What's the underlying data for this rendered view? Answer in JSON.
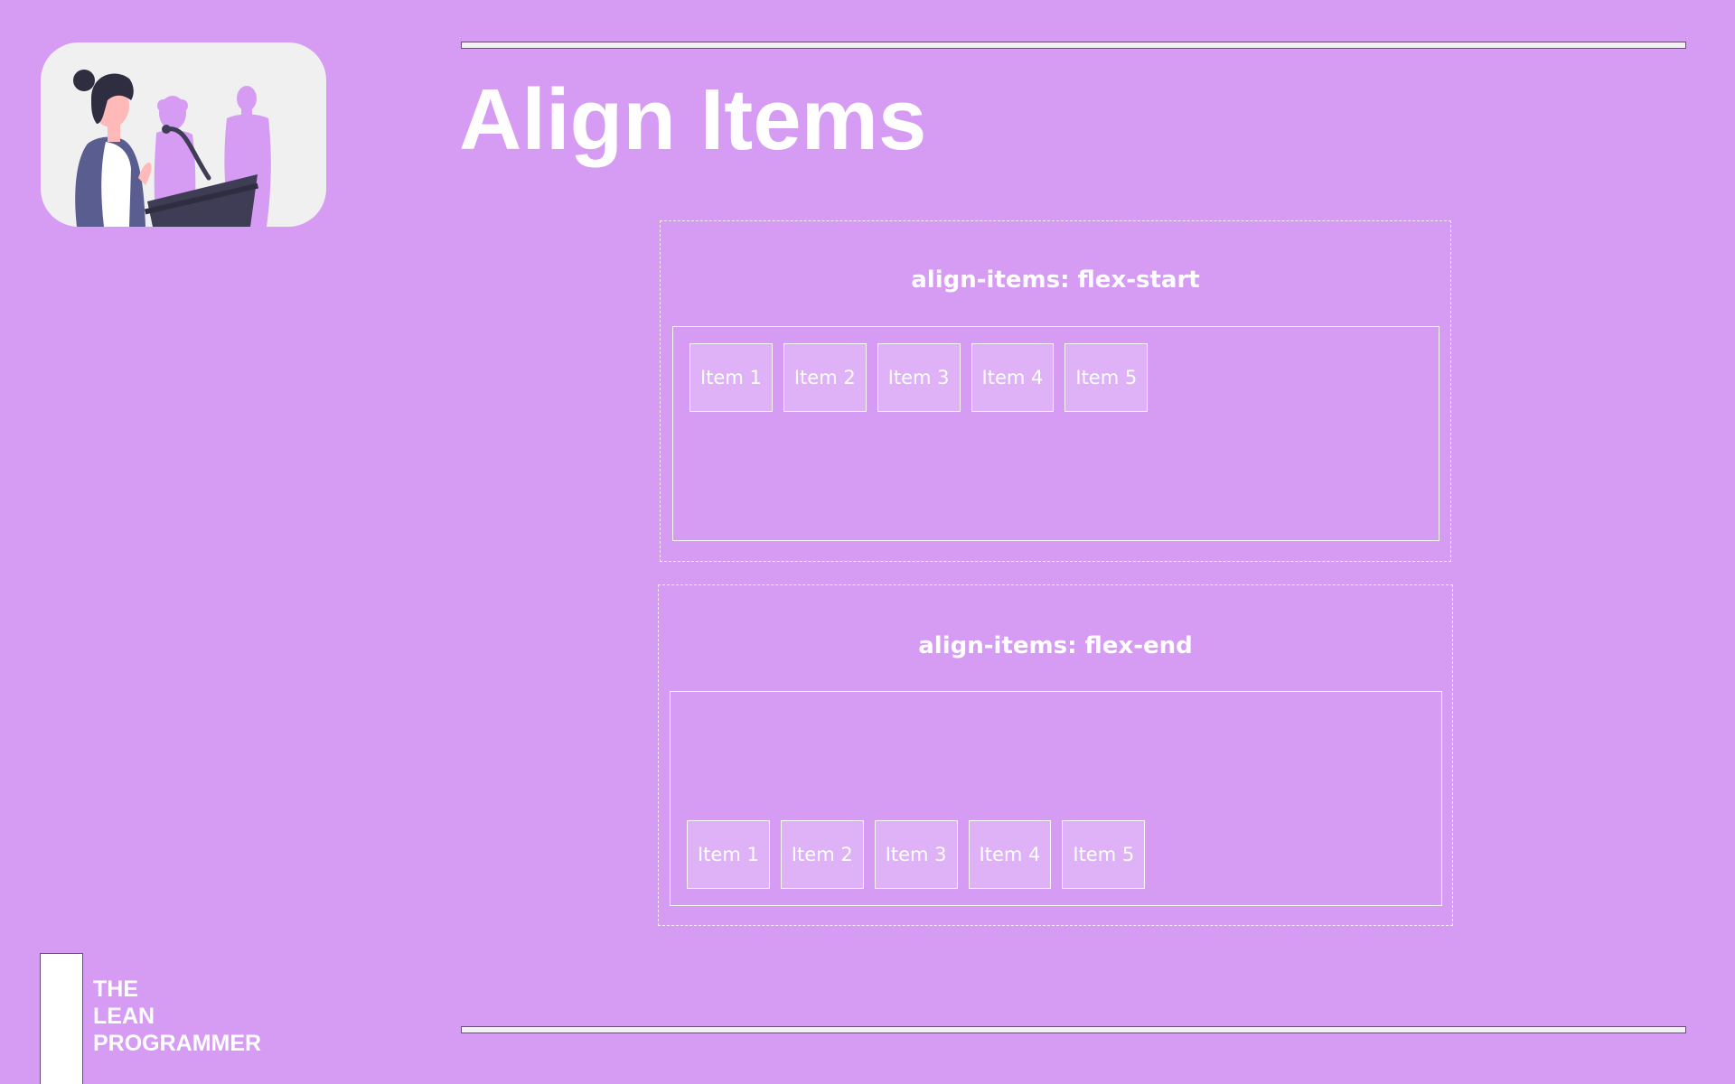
{
  "slide": {
    "title": "Align Items",
    "background_color": "#d69cf4"
  },
  "demos": [
    {
      "caption": "align-items: flex-start",
      "align": "flex-start",
      "items": [
        "Item 1",
        "Item 2",
        "Item 3",
        "Item 4",
        "Item 5"
      ]
    },
    {
      "caption": "align-items: flex-end",
      "align": "flex-end",
      "items": [
        "Item 1",
        "Item 2",
        "Item 3",
        "Item 4",
        "Item 5"
      ]
    }
  ],
  "brand": {
    "line1": "THE",
    "line2": "LEAN",
    "line3": "PROGRAMMER"
  },
  "illustration": {
    "icon": "speaker-at-podium-illustration"
  }
}
